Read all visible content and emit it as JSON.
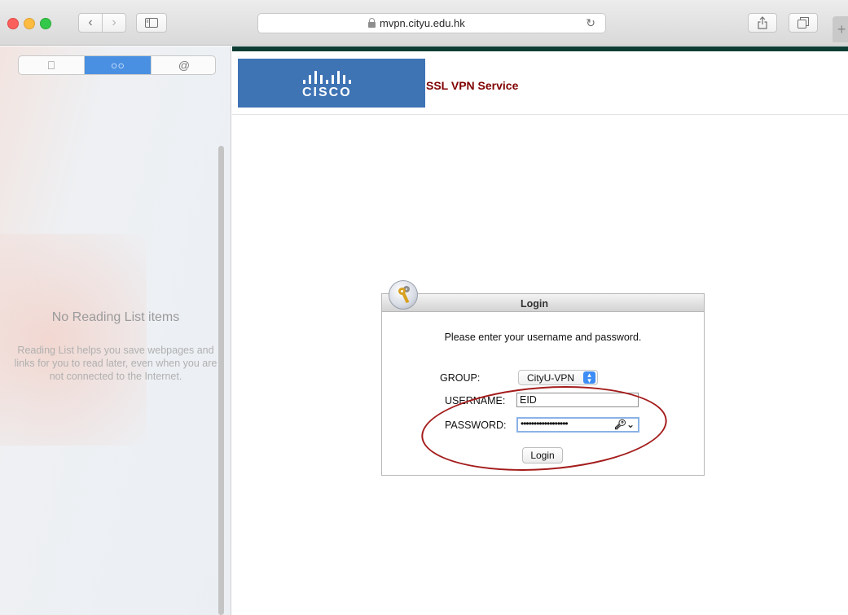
{
  "browser": {
    "url": "mvpn.cityu.edu.hk",
    "reload_icon": "↻",
    "new_tab_icon": "+"
  },
  "sidebar": {
    "tabs": [
      {
        "icon": "book-icon",
        "glyph": "⎕"
      },
      {
        "icon": "glasses-icon",
        "glyph": "○○"
      },
      {
        "icon": "at-icon",
        "glyph": "@"
      }
    ],
    "selected_tab": "glasses-icon",
    "empty_title": "No Reading List items",
    "empty_description": "Reading List helps you save webpages and links for you to read later, even when you are not connected to the Internet."
  },
  "page": {
    "logo_text": "cisco",
    "service_title": "SSL VPN Service",
    "login": {
      "title": "Login",
      "instructions": "Please enter your username and password.",
      "group_label": "GROUP:",
      "group_value": "CityU-VPN",
      "username_label": "USERNAME:",
      "username_value": "EID",
      "password_label": "PASSWORD:",
      "password_value": "••••••••••••••••••",
      "password_key_glyph": "🔑︎⌄",
      "button_label": "Login"
    }
  },
  "annotation_color": "#a41c1c",
  "accent_color": "#4a90e2"
}
